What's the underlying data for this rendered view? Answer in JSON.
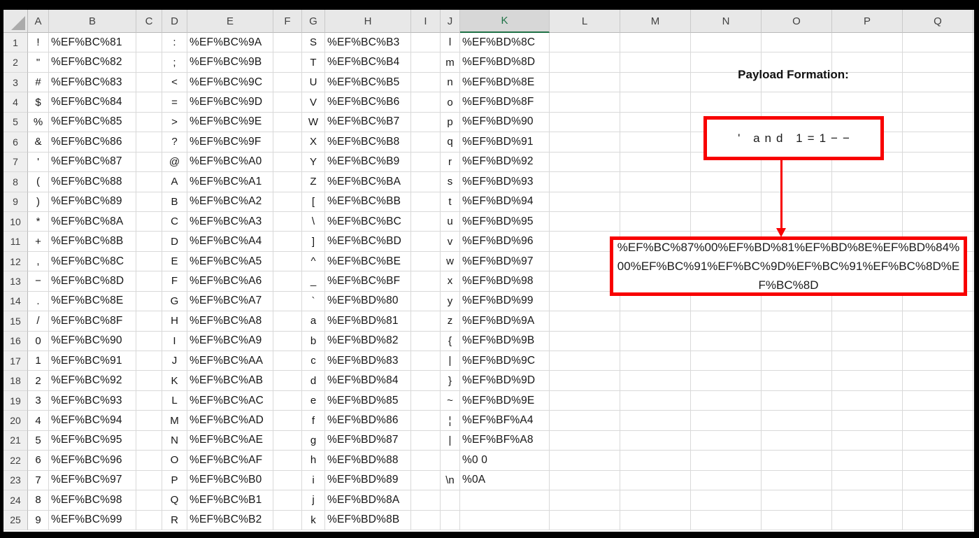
{
  "sheet": {
    "column_headers": [
      "A",
      "B",
      "C",
      "D",
      "E",
      "F",
      "G",
      "H",
      "I",
      "J",
      "K",
      "L",
      "M",
      "N",
      "O",
      "P",
      "Q"
    ],
    "selected_column": "K",
    "rows": [
      {
        "n": "1",
        "cells": [
          "!",
          "%EF%BC%81",
          ":",
          "%EF%BC%9A",
          "S",
          "%EF%BC%B3",
          "l",
          "%EF%BD%8C"
        ]
      },
      {
        "n": "2",
        "cells": [
          "\"",
          "%EF%BC%82",
          ";",
          "%EF%BC%9B",
          "T",
          "%EF%BC%B4",
          "m",
          "%EF%BD%8D"
        ]
      },
      {
        "n": "3",
        "cells": [
          "#",
          "%EF%BC%83",
          "<",
          "%EF%BC%9C",
          "U",
          "%EF%BC%B5",
          "n",
          "%EF%BD%8E"
        ]
      },
      {
        "n": "4",
        "cells": [
          "$",
          "%EF%BC%84",
          "=",
          "%EF%BC%9D",
          "V",
          "%EF%BC%B6",
          "o",
          "%EF%BD%8F"
        ]
      },
      {
        "n": "5",
        "cells": [
          "%",
          "%EF%BC%85",
          ">",
          "%EF%BC%9E",
          "W",
          "%EF%BC%B7",
          "p",
          "%EF%BD%90"
        ]
      },
      {
        "n": "6",
        "cells": [
          "&",
          "%EF%BC%86",
          "?",
          "%EF%BC%9F",
          "X",
          "%EF%BC%B8",
          "q",
          "%EF%BD%91"
        ]
      },
      {
        "n": "7",
        "cells": [
          "'",
          "%EF%BC%87",
          "@",
          "%EF%BC%A0",
          "Y",
          "%EF%BC%B9",
          "r",
          "%EF%BD%92"
        ]
      },
      {
        "n": "8",
        "cells": [
          "(",
          "%EF%BC%88",
          "A",
          "%EF%BC%A1",
          "Z",
          "%EF%BC%BA",
          "s",
          "%EF%BD%93"
        ]
      },
      {
        "n": "9",
        "cells": [
          ")",
          "%EF%BC%89",
          "B",
          "%EF%BC%A2",
          "[",
          "%EF%BC%BB",
          "t",
          "%EF%BD%94"
        ]
      },
      {
        "n": "10",
        "cells": [
          "*",
          "%EF%BC%8A",
          "C",
          "%EF%BC%A3",
          "\\",
          "%EF%BC%BC",
          "u",
          "%EF%BD%95"
        ]
      },
      {
        "n": "11",
        "cells": [
          "+",
          "%EF%BC%8B",
          "D",
          "%EF%BC%A4",
          "]",
          "%EF%BC%BD",
          "v",
          "%EF%BD%96"
        ]
      },
      {
        "n": "12",
        "cells": [
          ",",
          "%EF%BC%8C",
          "E",
          "%EF%BC%A5",
          "^",
          "%EF%BC%BE",
          "w",
          "%EF%BD%97"
        ]
      },
      {
        "n": "13",
        "cells": [
          "−",
          "%EF%BC%8D",
          "F",
          "%EF%BC%A6",
          "_",
          "%EF%BC%BF",
          "x",
          "%EF%BD%98"
        ]
      },
      {
        "n": "14",
        "cells": [
          ".",
          "%EF%BC%8E",
          "G",
          "%EF%BC%A7",
          "`",
          "%EF%BD%80",
          "y",
          "%EF%BD%99"
        ]
      },
      {
        "n": "15",
        "cells": [
          "/",
          "%EF%BC%8F",
          "H",
          "%EF%BC%A8",
          "a",
          "%EF%BD%81",
          "z",
          "%EF%BD%9A"
        ]
      },
      {
        "n": "16",
        "cells": [
          "0",
          "%EF%BC%90",
          "I",
          "%EF%BC%A9",
          "b",
          "%EF%BD%82",
          "{",
          "%EF%BD%9B"
        ]
      },
      {
        "n": "17",
        "cells": [
          "1",
          "%EF%BC%91",
          "J",
          "%EF%BC%AA",
          "c",
          "%EF%BD%83",
          "|",
          "%EF%BD%9C"
        ]
      },
      {
        "n": "18",
        "cells": [
          "2",
          "%EF%BC%92",
          "K",
          "%EF%BC%AB",
          "d",
          "%EF%BD%84",
          "}",
          "%EF%BD%9D"
        ]
      },
      {
        "n": "19",
        "cells": [
          "3",
          "%EF%BC%93",
          "L",
          "%EF%BC%AC",
          "e",
          "%EF%BD%85",
          "~",
          "%EF%BD%9E"
        ]
      },
      {
        "n": "20",
        "cells": [
          "4",
          "%EF%BC%94",
          "M",
          "%EF%BC%AD",
          "f",
          "%EF%BD%86",
          "¦",
          "%EF%BF%A4"
        ]
      },
      {
        "n": "21",
        "cells": [
          "5",
          "%EF%BC%95",
          "N",
          "%EF%BC%AE",
          "g",
          "%EF%BD%87",
          "|",
          "%EF%BF%A8"
        ]
      },
      {
        "n": "22",
        "cells": [
          "6",
          "%EF%BC%96",
          "O",
          "%EF%BC%AF",
          "h",
          "%EF%BD%88",
          "",
          "%0 0"
        ]
      },
      {
        "n": "23",
        "cells": [
          "7",
          "%EF%BC%97",
          "P",
          "%EF%BC%B0",
          "i",
          "%EF%BD%89",
          "\\n",
          "%0A"
        ]
      },
      {
        "n": "24",
        "cells": [
          "8",
          "%EF%BC%98",
          "Q",
          "%EF%BC%B1",
          "j",
          "%EF%BD%8A",
          "",
          ""
        ]
      },
      {
        "n": "25",
        "cells": [
          "9",
          "%EF%BC%99",
          "R",
          "%EF%BC%B2",
          "k",
          "%EF%BD%8B",
          "",
          ""
        ]
      }
    ]
  },
  "annotation": {
    "title": "Payload Formation:",
    "payload_input": "' and 1=1−−",
    "payload_encoded": "%EF%BC%87%00%EF%BD%81%EF%BD%8E%EF%BD%84%00%EF%BC%91%EF%BC%9D%EF%BC%91%EF%BC%8D%EF%BC%8D",
    "accent_color": "#f80000"
  }
}
